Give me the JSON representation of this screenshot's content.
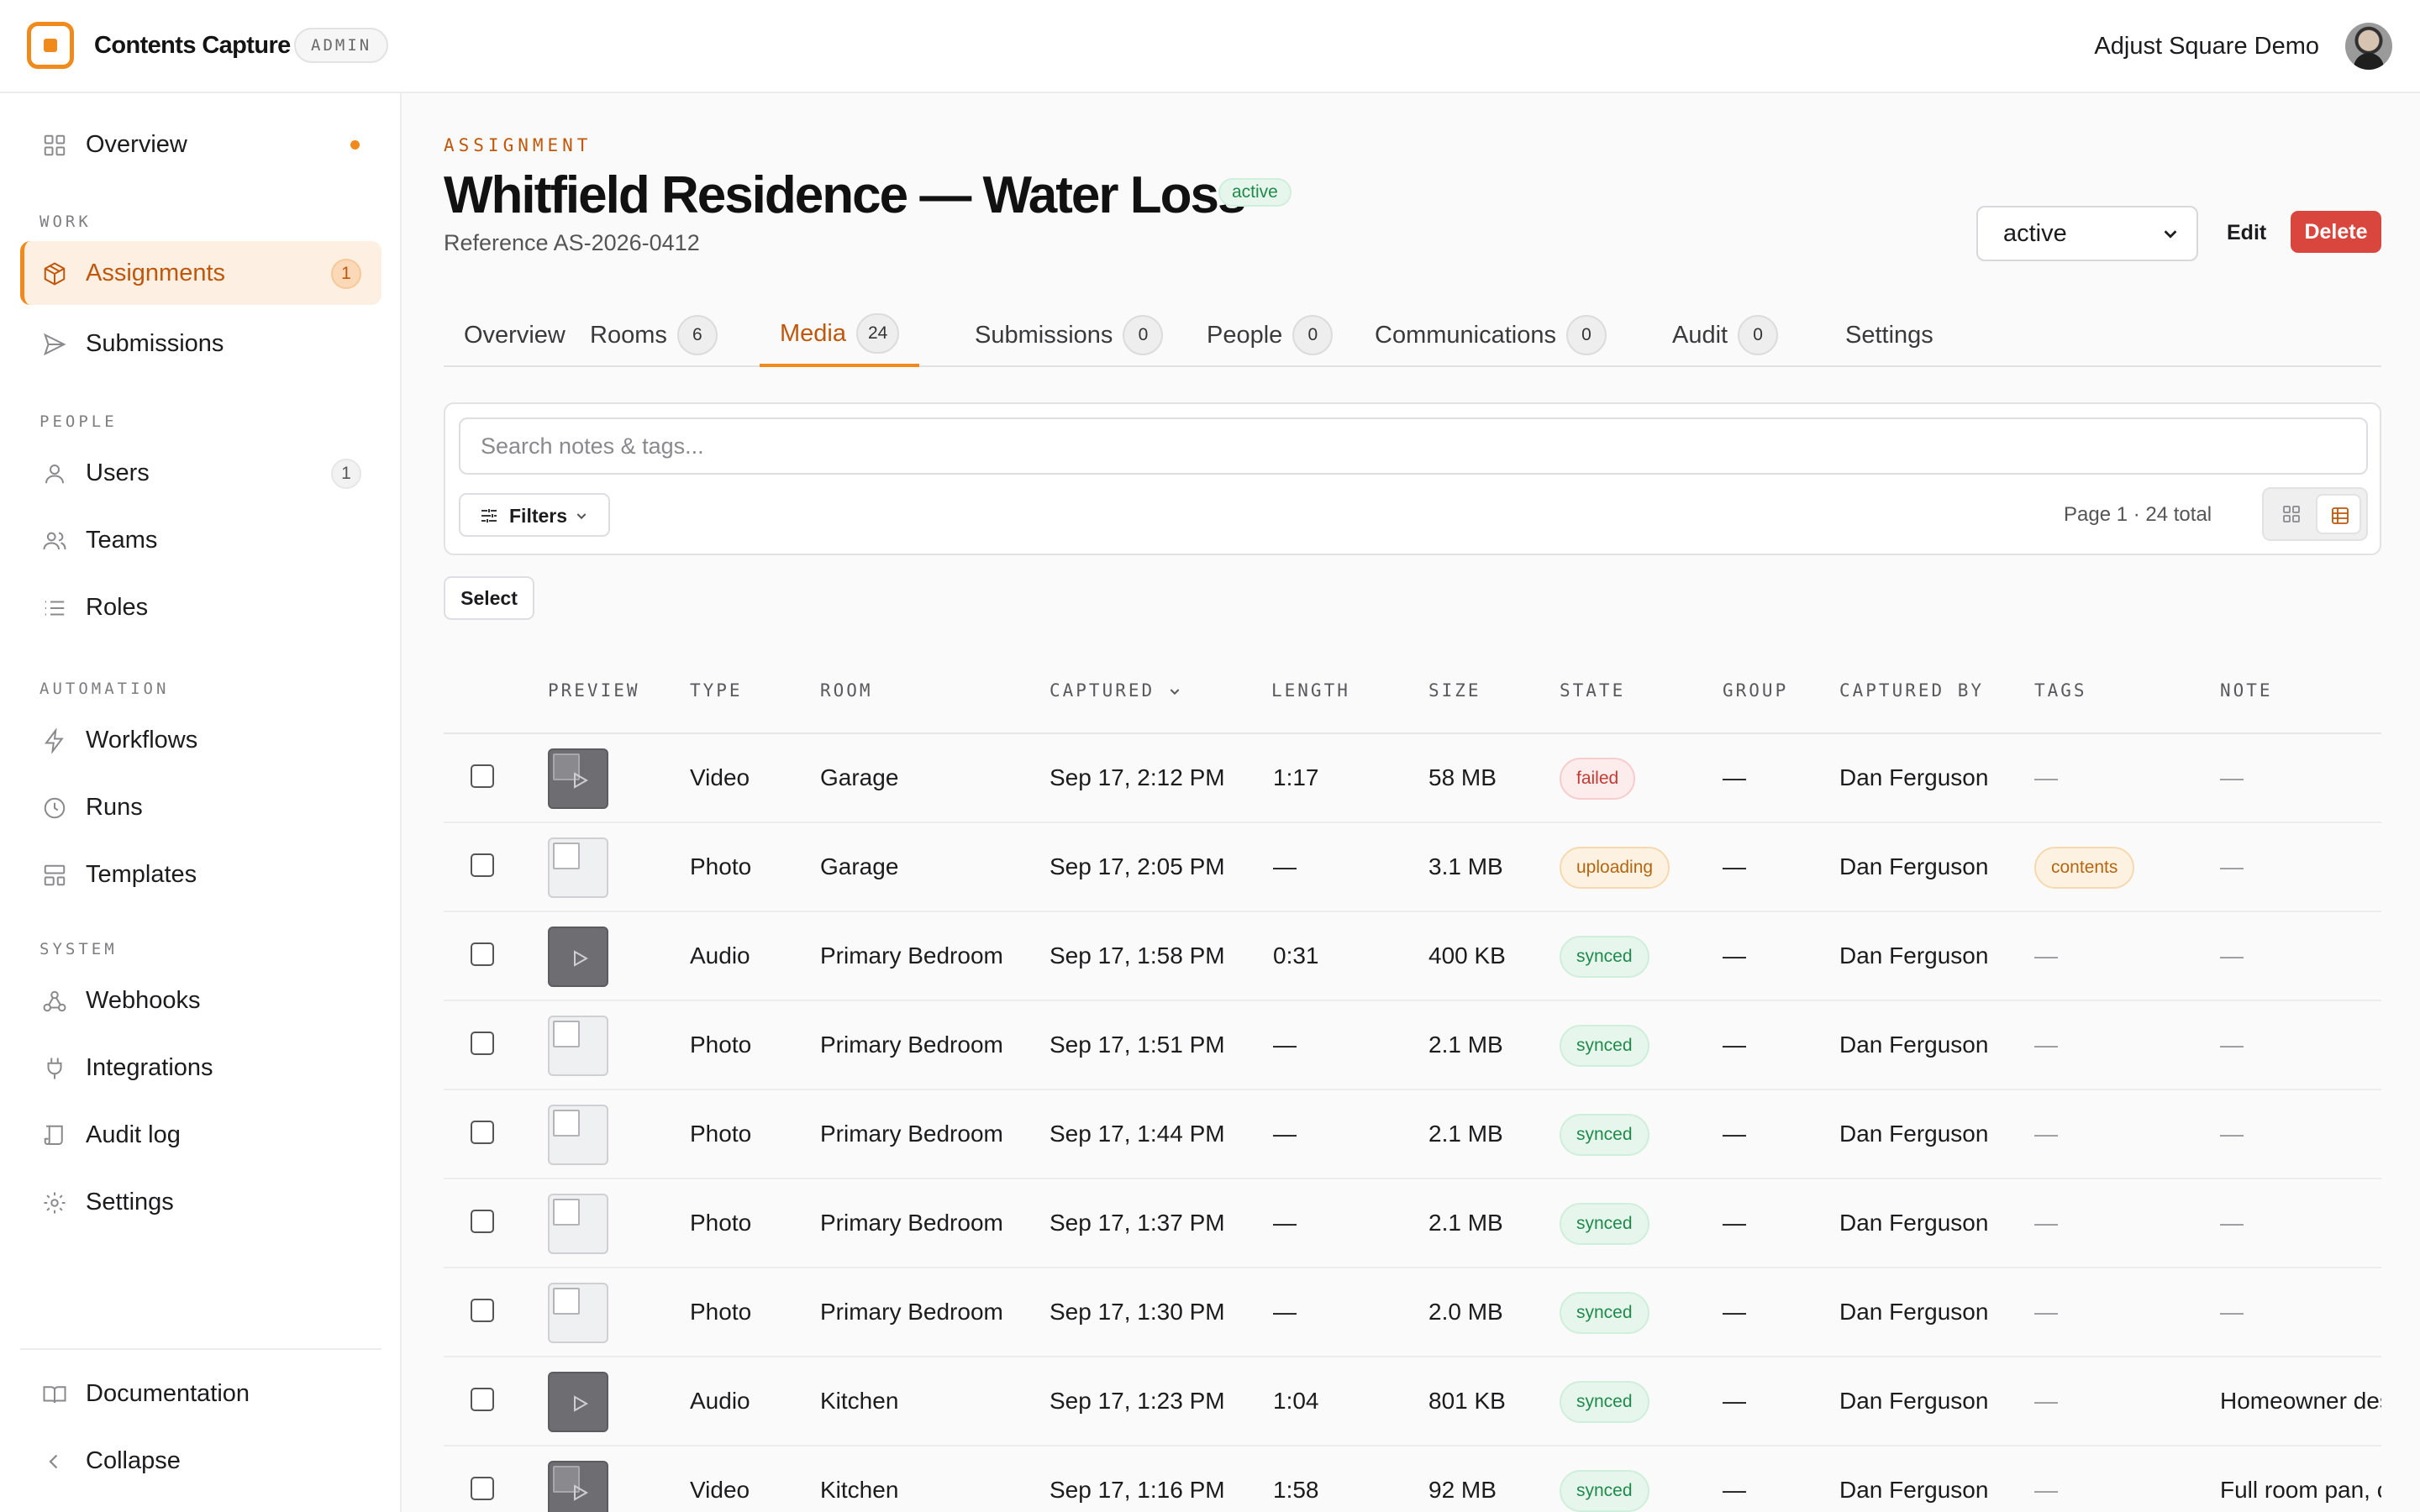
{
  "app": {
    "brand": "Contents Capture",
    "role_badge": "ADMIN",
    "account_name": "Adjust Square Demo"
  },
  "sidebar": {
    "overview": "Overview",
    "sections": {
      "work": "WORK",
      "people": "PEOPLE",
      "automation": "AUTOMATION",
      "system": "SYSTEM"
    },
    "items": {
      "assignments": {
        "label": "Assignments",
        "count": "1"
      },
      "submissions": {
        "label": "Submissions"
      },
      "users": {
        "label": "Users",
        "count": "1"
      },
      "teams": {
        "label": "Teams"
      },
      "roles": {
        "label": "Roles"
      },
      "workflows": {
        "label": "Workflows"
      },
      "runs": {
        "label": "Runs"
      },
      "templates": {
        "label": "Templates"
      },
      "webhooks": {
        "label": "Webhooks"
      },
      "integrations": {
        "label": "Integrations"
      },
      "audit_log": {
        "label": "Audit log"
      },
      "settings": {
        "label": "Settings"
      }
    },
    "footer": {
      "documentation": "Documentation",
      "collapse": "Collapse"
    }
  },
  "assignment": {
    "eyebrow": "ASSIGNMENT",
    "title": "Whitfield Residence — Water Loss",
    "status": "active",
    "reference": "Reference AS-2026-0412",
    "status_select_value": "active",
    "edit_label": "Edit",
    "delete_label": "Delete"
  },
  "tabs": [
    {
      "label": "Overview",
      "count": null
    },
    {
      "label": "Rooms",
      "count": "6"
    },
    {
      "label": "Media",
      "count": "24"
    },
    {
      "label": "Submissions",
      "count": "0"
    },
    {
      "label": "People",
      "count": "0"
    },
    {
      "label": "Communications",
      "count": "0"
    },
    {
      "label": "Audit",
      "count": "0"
    },
    {
      "label": "Settings",
      "count": null
    }
  ],
  "media": {
    "search_placeholder": "Search notes & tags...",
    "filters_label": "Filters",
    "page_info": "Page 1 · 24 total",
    "select_label": "Select",
    "columns": [
      "PREVIEW",
      "TYPE",
      "ROOM",
      "CAPTURED",
      "LENGTH",
      "SIZE",
      "STATE",
      "GROUP",
      "CAPTURED BY",
      "TAGS",
      "NOTE"
    ],
    "rows": [
      {
        "type": "Video",
        "room": "Garage",
        "captured": "Sep 17, 2:12 PM",
        "length": "1:17",
        "size": "58 MB",
        "state": "failed",
        "group": "—",
        "captured_by": "Dan Ferguson",
        "tags": "—",
        "note": "—"
      },
      {
        "type": "Photo",
        "room": "Garage",
        "captured": "Sep 17, 2:05 PM",
        "length": "—",
        "size": "3.1 MB",
        "state": "uploading",
        "group": "—",
        "captured_by": "Dan Ferguson",
        "tags": "contents",
        "note": "—"
      },
      {
        "type": "Audio",
        "room": "Primary Bedroom",
        "captured": "Sep 17, 1:58 PM",
        "length": "0:31",
        "size": "400 KB",
        "state": "synced",
        "group": "—",
        "captured_by": "Dan Ferguson",
        "tags": "—",
        "note": "—"
      },
      {
        "type": "Photo",
        "room": "Primary Bedroom",
        "captured": "Sep 17, 1:51 PM",
        "length": "—",
        "size": "2.1 MB",
        "state": "synced",
        "group": "—",
        "captured_by": "Dan Ferguson",
        "tags": "—",
        "note": "—"
      },
      {
        "type": "Photo",
        "room": "Primary Bedroom",
        "captured": "Sep 17, 1:44 PM",
        "length": "—",
        "size": "2.1 MB",
        "state": "synced",
        "group": "—",
        "captured_by": "Dan Ferguson",
        "tags": "—",
        "note": "—"
      },
      {
        "type": "Photo",
        "room": "Primary Bedroom",
        "captured": "Sep 17, 1:37 PM",
        "length": "—",
        "size": "2.1 MB",
        "state": "synced",
        "group": "—",
        "captured_by": "Dan Ferguson",
        "tags": "—",
        "note": "—"
      },
      {
        "type": "Photo",
        "room": "Primary Bedroom",
        "captured": "Sep 17, 1:30 PM",
        "length": "—",
        "size": "2.0 MB",
        "state": "synced",
        "group": "—",
        "captured_by": "Dan Ferguson",
        "tags": "—",
        "note": "—"
      },
      {
        "type": "Audio",
        "room": "Kitchen",
        "captured": "Sep 17, 1:23 PM",
        "length": "1:04",
        "size": "801 KB",
        "state": "synced",
        "group": "—",
        "captured_by": "Dan Ferguson",
        "tags": "—",
        "note": "Homeowner des"
      },
      {
        "type": "Video",
        "room": "Kitchen",
        "captured": "Sep 17, 1:16 PM",
        "length": "1:58",
        "size": "92 MB",
        "state": "synced",
        "group": "—",
        "captured_by": "Dan Ferguson",
        "tags": "—",
        "note": "Full room pan, c"
      }
    ]
  },
  "colors": {
    "accent": "#f08a1c",
    "accent_text": "#c0570a",
    "danger": "#d9463e",
    "success": "#1f8a4c"
  }
}
